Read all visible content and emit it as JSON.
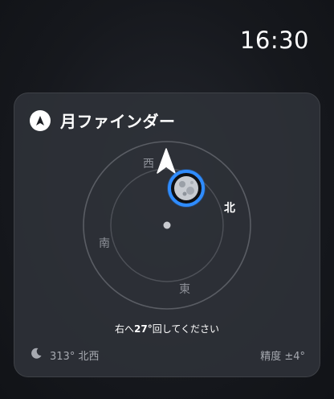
{
  "status_bar": {
    "time": "16:30"
  },
  "widget": {
    "title": "月ファインダー",
    "icon": "navigation-arrow-icon",
    "compass": {
      "directions": {
        "north": "北",
        "east": "東",
        "south": "南",
        "west": "西"
      },
      "moon_icon": "full-moon-icon",
      "pointer_icon": "heading-arrow-icon"
    },
    "instruction": {
      "prefix": "右へ",
      "degrees": "27°",
      "suffix": "回してください"
    },
    "footer": {
      "moon_icon": "crescent-moon-icon",
      "azimuth": "313° 北西",
      "accuracy": "精度 ±4°"
    },
    "colors": {
      "accent": "#2f8cff",
      "card_background": "#2f3239",
      "ring": "#5a5d64"
    }
  }
}
